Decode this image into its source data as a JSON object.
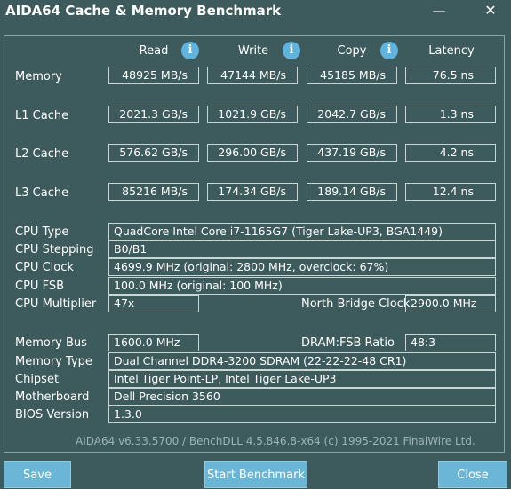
{
  "window": {
    "title": "AIDA64 Cache & Memory Benchmark",
    "minimize": "—",
    "close": "✕"
  },
  "headers": {
    "read": "Read",
    "write": "Write",
    "copy": "Copy",
    "latency": "Latency",
    "info": "i"
  },
  "bench": [
    {
      "label": "Memory",
      "read": "48925 MB/s",
      "write": "47144 MB/s",
      "copy": "45185 MB/s",
      "latency": "76.5 ns"
    },
    {
      "label": "L1 Cache",
      "read": "2021.3 GB/s",
      "write": "1021.9 GB/s",
      "copy": "2042.7 GB/s",
      "latency": "1.3 ns"
    },
    {
      "label": "L2 Cache",
      "read": "576.62 GB/s",
      "write": "296.00 GB/s",
      "copy": "437.19 GB/s",
      "latency": "4.2 ns"
    },
    {
      "label": "L3 Cache",
      "read": "85216 MB/s",
      "write": "174.34 GB/s",
      "copy": "189.14 GB/s",
      "latency": "12.4 ns"
    }
  ],
  "cpu": {
    "type_label": "CPU Type",
    "type": "QuadCore Intel Core i7-1165G7  (Tiger Lake-UP3, BGA1449)",
    "stepping_label": "CPU Stepping",
    "stepping": "B0/B1",
    "clock_label": "CPU Clock",
    "clock": "4699.9 MHz  (original: 2800 MHz, overclock: 67%)",
    "fsb_label": "CPU FSB",
    "fsb": "100.0 MHz  (original: 100 MHz)",
    "mult_label": "CPU Multiplier",
    "mult": "47x",
    "nb_label": "North Bridge Clock",
    "nb": "2900.0 MHz"
  },
  "mem": {
    "bus_label": "Memory Bus",
    "bus": "1600.0 MHz",
    "ratio_label": "DRAM:FSB Ratio",
    "ratio": "48:3",
    "type_label": "Memory Type",
    "type": "Dual Channel DDR4-3200 SDRAM  (22-22-22-48 CR1)",
    "chipset_label": "Chipset",
    "chipset": "Intel Tiger Point-LP, Intel Tiger Lake-UP3",
    "mb_label": "Motherboard",
    "mb": "Dell Precision 3560",
    "bios_label": "BIOS Version",
    "bios": "1.3.0"
  },
  "footer": "AIDA64 v6.33.5700 / BenchDLL 4.5.846.8-x64  (c) 1995-2021 FinalWire Ltd.",
  "buttons": {
    "save": "Save",
    "start": "Start Benchmark",
    "close": "Close"
  }
}
